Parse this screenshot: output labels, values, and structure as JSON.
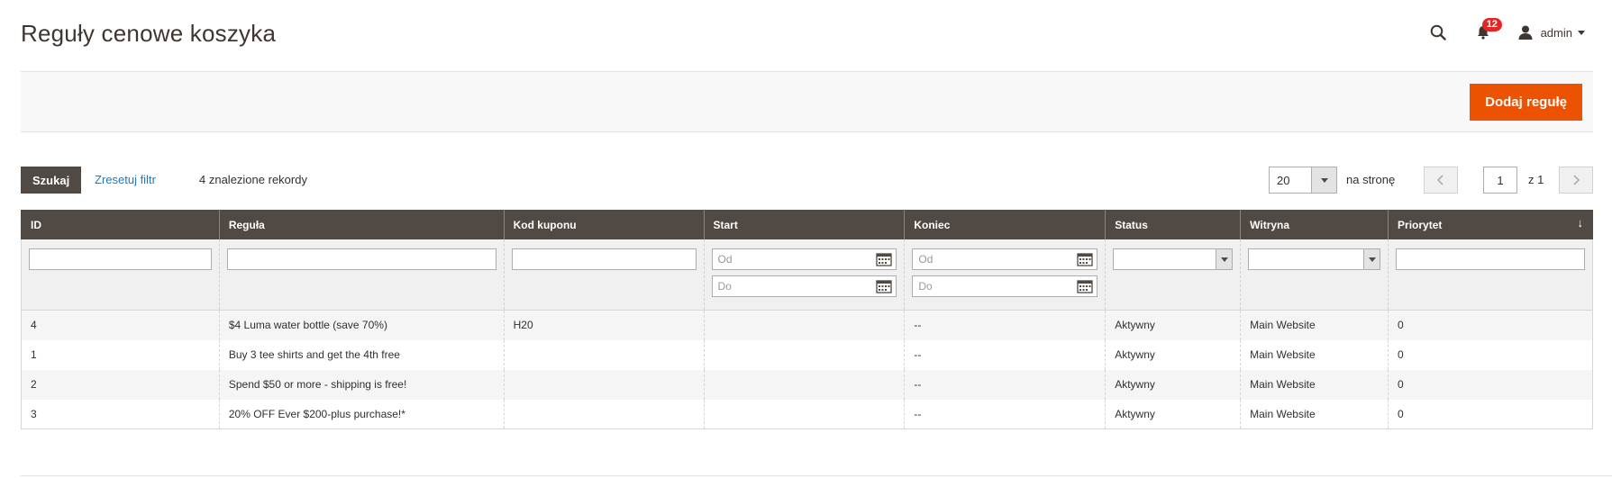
{
  "page": {
    "title": "Reguły cenowe koszyka"
  },
  "header": {
    "notifications_count": "12",
    "user_name": "admin"
  },
  "actions": {
    "add_rule_label": "Dodaj regułę"
  },
  "toolbar": {
    "search_label": "Szukaj",
    "reset_label": "Zresetuj filtr",
    "records_label": "4 znalezione rekordy",
    "per_page_value": "20",
    "per_page_label": "na stronę",
    "page_value": "1",
    "page_total_label": "z 1"
  },
  "columns": [
    "ID",
    "Reguła",
    "Kod kuponu",
    "Start",
    "Koniec",
    "Status",
    "Witryna",
    "Priorytet"
  ],
  "filters": {
    "date_from_placeholder": "Od",
    "date_to_placeholder": "Do"
  },
  "rows": [
    {
      "id": "4",
      "rule": "$4 Luma water bottle (save 70%)",
      "coupon": "H20",
      "start": "",
      "end": "--",
      "status": "Aktywny",
      "website": "Main Website",
      "priority": "0"
    },
    {
      "id": "1",
      "rule": "Buy 3 tee shirts and get the 4th free",
      "coupon": "",
      "start": "",
      "end": "--",
      "status": "Aktywny",
      "website": "Main Website",
      "priority": "0"
    },
    {
      "id": "2",
      "rule": "Spend $50 or more - shipping is free!",
      "coupon": "",
      "start": "",
      "end": "--",
      "status": "Aktywny",
      "website": "Main Website",
      "priority": "0"
    },
    {
      "id": "3",
      "rule": "20% OFF Ever $200-plus purchase!*",
      "coupon": "",
      "start": "",
      "end": "--",
      "status": "Aktywny",
      "website": "Main Website",
      "priority": "0"
    }
  ],
  "colors": {
    "accent": "#eb5202",
    "header_bg": "#514943",
    "link": "#1979c3",
    "badge": "#e22626"
  },
  "icons": {
    "search": "search-icon",
    "bell": "bell-icon",
    "user": "user-icon",
    "calendar": "calendar-icon",
    "sort": "sort-arrow-icon"
  }
}
